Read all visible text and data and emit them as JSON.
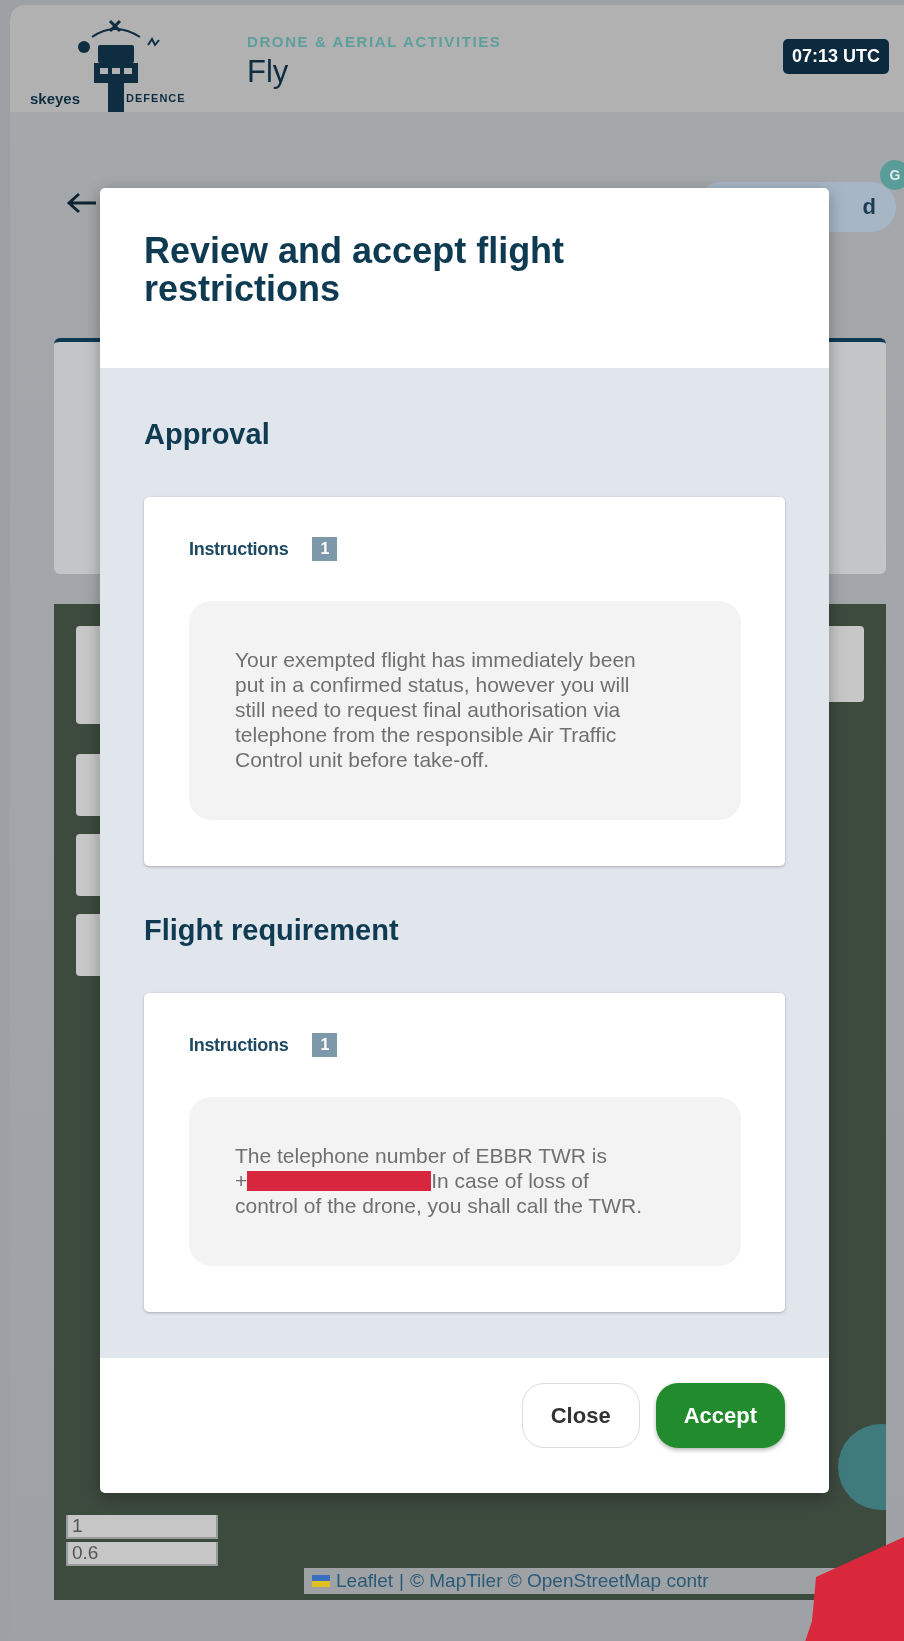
{
  "header": {
    "logo_text": "skeyes",
    "logo_partner": "DEFENCE",
    "subtitle": "DRONE & AERIAL ACTIVITIES",
    "title": "Fly",
    "time": "07:13 UTC"
  },
  "background": {
    "status_pill": "d",
    "badge": "G",
    "map_scale": [
      "1",
      "0.6"
    ],
    "attribution_link": "Leaflet",
    "attribution_separator": "|",
    "attribution": "© MapTiler © OpenStreetMap contr"
  },
  "modal": {
    "title": "Review and accept flight restrictions",
    "sections": [
      {
        "heading": "Approval",
        "label": "Instructions",
        "count": "1",
        "paragraph": [
          [
            {
              "kind": "text",
              "text": "Your exempted flight has immediately been put in a confirmed status, however you will still need to request final authorisation via telephone from the responsible Air Traffic Control unit before take-off."
            }
          ]
        ]
      },
      {
        "heading": "Flight requirement",
        "label": "Instructions",
        "count": "1",
        "paragraph": [
          [
            {
              "kind": "text",
              "text": "The telephone number of EBBR TWR is"
            }
          ],
          [
            {
              "kind": "text",
              "text": "+"
            },
            {
              "kind": "redaction"
            },
            {
              "kind": "text",
              "text": "In case of loss of"
            }
          ],
          [
            {
              "kind": "text",
              "text": "control of the drone, you shall call the TWR."
            }
          ]
        ]
      }
    ],
    "buttons": [
      {
        "label": "Close",
        "kind": "secondary"
      },
      {
        "label": "Accept",
        "kind": "primary"
      }
    ]
  }
}
